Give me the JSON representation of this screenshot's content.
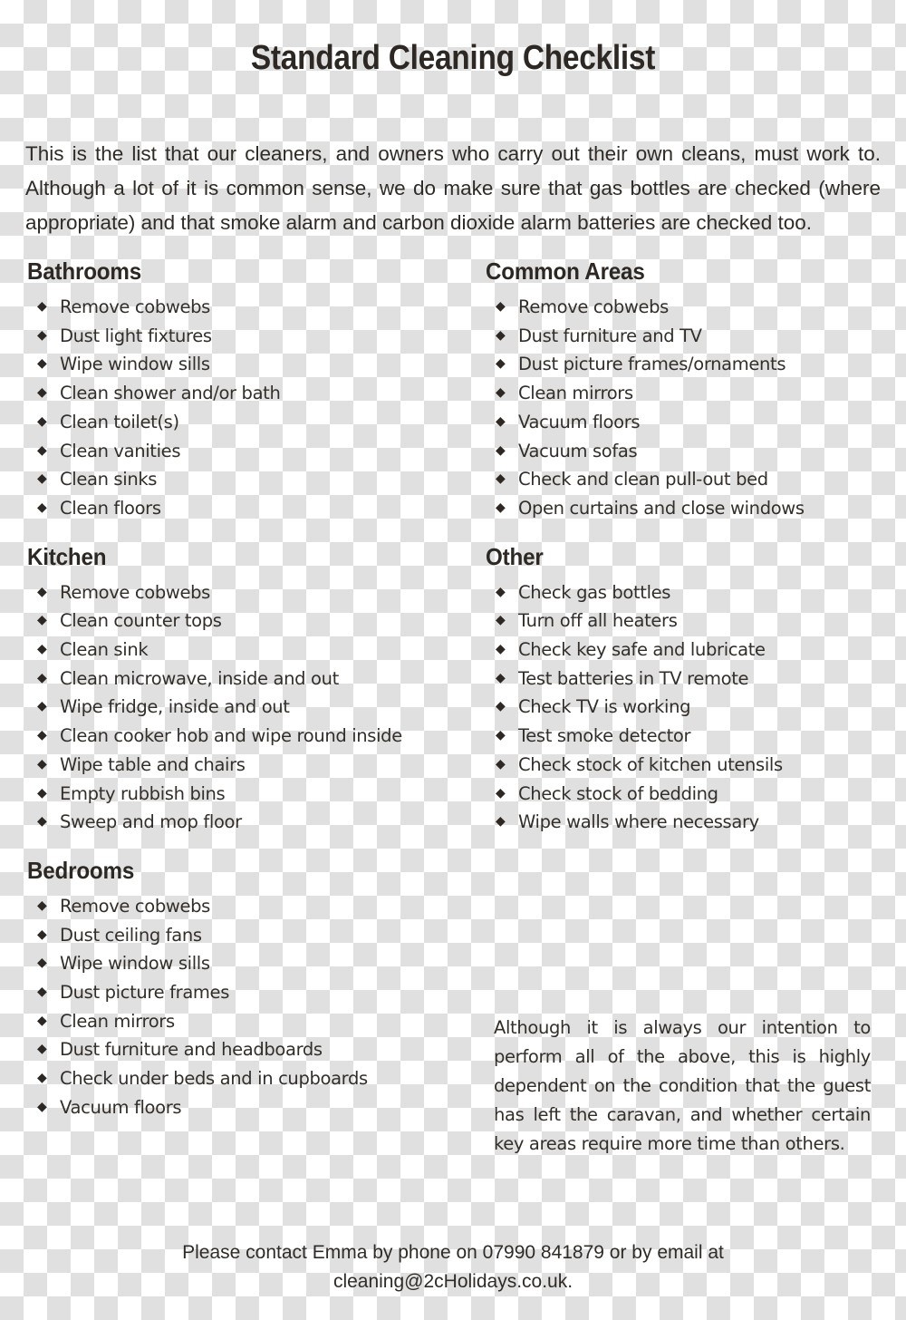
{
  "document": {
    "title": "Standard Cleaning Checklist",
    "intro": "This is the list that our cleaners, and owners who carry out their own cleans, must work to. Although a lot of it is common sense, we do make sure that gas bottles are checked (where appropriate) and that smoke alarm and carbon dioxide alarm batteries are checked too.",
    "closing_note": "Although it is always our intention to perform all of the above, this is highly dependent on the condition that the guest has left the caravan, and whether certain key areas require more time than others.",
    "bullet_glyph": "◆",
    "text_color": "#332e2a",
    "heading_color": "#2d2823",
    "background_checker_color": "#e0e0e0"
  },
  "sections": {
    "bathrooms": {
      "heading": "Bathrooms",
      "items": [
        "Remove cobwebs",
        "Dust light fixtures",
        "Wipe window sills",
        "Clean shower and/or bath",
        "Clean toilet(s)",
        "Clean vanities",
        "Clean sinks",
        "Clean floors"
      ]
    },
    "kitchen": {
      "heading": "Kitchen",
      "items": [
        "Remove cobwebs",
        "Clean counter tops",
        "Clean sink",
        "Clean microwave, inside and out",
        "Wipe fridge, inside and out",
        "Clean cooker hob and wipe round inside",
        "Wipe table and chairs",
        "Empty rubbish bins",
        "Sweep and mop floor"
      ]
    },
    "bedrooms": {
      "heading": "Bedrooms",
      "items": [
        "Remove cobwebs",
        "Dust ceiling fans",
        "Wipe window sills",
        "Dust picture frames",
        "Clean mirrors",
        "Dust furniture and headboards",
        "Check under beds and in cupboards",
        "Vacuum floors"
      ]
    },
    "common_areas": {
      "heading": "Common Areas",
      "items": [
        "Remove cobwebs",
        "Dust furniture and TV",
        "Dust picture frames/ornaments",
        "Clean mirrors",
        "Vacuum floors",
        "Vacuum sofas",
        "Check and clean pull-out bed",
        "Open curtains and close windows"
      ]
    },
    "other": {
      "heading": "Other",
      "items": [
        "Check gas bottles",
        "Turn off all heaters",
        "Check key safe and lubricate",
        "Test batteries in TV remote",
        "Check TV is working",
        "Test smoke detector",
        "Check stock of kitchen utensils",
        "Check stock of bedding",
        "Wipe walls where necessary"
      ]
    }
  },
  "footer": {
    "line1": "Please contact Emma by phone on 07990 841879 or by email at",
    "line2": "cleaning@2cHolidays.co.uk."
  }
}
